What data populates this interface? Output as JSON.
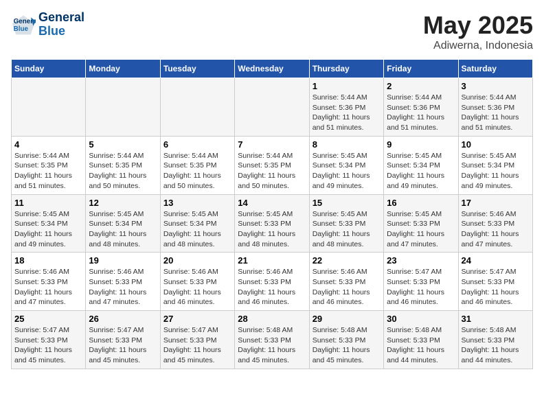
{
  "header": {
    "logo_line1": "General",
    "logo_line2": "Blue",
    "title": "May 2025",
    "subtitle": "Adiwerna, Indonesia"
  },
  "days_of_week": [
    "Sunday",
    "Monday",
    "Tuesday",
    "Wednesday",
    "Thursday",
    "Friday",
    "Saturday"
  ],
  "weeks": [
    [
      {
        "day": "",
        "info": ""
      },
      {
        "day": "",
        "info": ""
      },
      {
        "day": "",
        "info": ""
      },
      {
        "day": "",
        "info": ""
      },
      {
        "day": "1",
        "info": "Sunrise: 5:44 AM\nSunset: 5:36 PM\nDaylight: 11 hours\nand 51 minutes."
      },
      {
        "day": "2",
        "info": "Sunrise: 5:44 AM\nSunset: 5:36 PM\nDaylight: 11 hours\nand 51 minutes."
      },
      {
        "day": "3",
        "info": "Sunrise: 5:44 AM\nSunset: 5:36 PM\nDaylight: 11 hours\nand 51 minutes."
      }
    ],
    [
      {
        "day": "4",
        "info": "Sunrise: 5:44 AM\nSunset: 5:35 PM\nDaylight: 11 hours\nand 51 minutes."
      },
      {
        "day": "5",
        "info": "Sunrise: 5:44 AM\nSunset: 5:35 PM\nDaylight: 11 hours\nand 50 minutes."
      },
      {
        "day": "6",
        "info": "Sunrise: 5:44 AM\nSunset: 5:35 PM\nDaylight: 11 hours\nand 50 minutes."
      },
      {
        "day": "7",
        "info": "Sunrise: 5:44 AM\nSunset: 5:35 PM\nDaylight: 11 hours\nand 50 minutes."
      },
      {
        "day": "8",
        "info": "Sunrise: 5:45 AM\nSunset: 5:34 PM\nDaylight: 11 hours\nand 49 minutes."
      },
      {
        "day": "9",
        "info": "Sunrise: 5:45 AM\nSunset: 5:34 PM\nDaylight: 11 hours\nand 49 minutes."
      },
      {
        "day": "10",
        "info": "Sunrise: 5:45 AM\nSunset: 5:34 PM\nDaylight: 11 hours\nand 49 minutes."
      }
    ],
    [
      {
        "day": "11",
        "info": "Sunrise: 5:45 AM\nSunset: 5:34 PM\nDaylight: 11 hours\nand 49 minutes."
      },
      {
        "day": "12",
        "info": "Sunrise: 5:45 AM\nSunset: 5:34 PM\nDaylight: 11 hours\nand 48 minutes."
      },
      {
        "day": "13",
        "info": "Sunrise: 5:45 AM\nSunset: 5:34 PM\nDaylight: 11 hours\nand 48 minutes."
      },
      {
        "day": "14",
        "info": "Sunrise: 5:45 AM\nSunset: 5:33 PM\nDaylight: 11 hours\nand 48 minutes."
      },
      {
        "day": "15",
        "info": "Sunrise: 5:45 AM\nSunset: 5:33 PM\nDaylight: 11 hours\nand 48 minutes."
      },
      {
        "day": "16",
        "info": "Sunrise: 5:45 AM\nSunset: 5:33 PM\nDaylight: 11 hours\nand 47 minutes."
      },
      {
        "day": "17",
        "info": "Sunrise: 5:46 AM\nSunset: 5:33 PM\nDaylight: 11 hours\nand 47 minutes."
      }
    ],
    [
      {
        "day": "18",
        "info": "Sunrise: 5:46 AM\nSunset: 5:33 PM\nDaylight: 11 hours\nand 47 minutes."
      },
      {
        "day": "19",
        "info": "Sunrise: 5:46 AM\nSunset: 5:33 PM\nDaylight: 11 hours\nand 47 minutes."
      },
      {
        "day": "20",
        "info": "Sunrise: 5:46 AM\nSunset: 5:33 PM\nDaylight: 11 hours\nand 46 minutes."
      },
      {
        "day": "21",
        "info": "Sunrise: 5:46 AM\nSunset: 5:33 PM\nDaylight: 11 hours\nand 46 minutes."
      },
      {
        "day": "22",
        "info": "Sunrise: 5:46 AM\nSunset: 5:33 PM\nDaylight: 11 hours\nand 46 minutes."
      },
      {
        "day": "23",
        "info": "Sunrise: 5:47 AM\nSunset: 5:33 PM\nDaylight: 11 hours\nand 46 minutes."
      },
      {
        "day": "24",
        "info": "Sunrise: 5:47 AM\nSunset: 5:33 PM\nDaylight: 11 hours\nand 46 minutes."
      }
    ],
    [
      {
        "day": "25",
        "info": "Sunrise: 5:47 AM\nSunset: 5:33 PM\nDaylight: 11 hours\nand 45 minutes."
      },
      {
        "day": "26",
        "info": "Sunrise: 5:47 AM\nSunset: 5:33 PM\nDaylight: 11 hours\nand 45 minutes."
      },
      {
        "day": "27",
        "info": "Sunrise: 5:47 AM\nSunset: 5:33 PM\nDaylight: 11 hours\nand 45 minutes."
      },
      {
        "day": "28",
        "info": "Sunrise: 5:48 AM\nSunset: 5:33 PM\nDaylight: 11 hours\nand 45 minutes."
      },
      {
        "day": "29",
        "info": "Sunrise: 5:48 AM\nSunset: 5:33 PM\nDaylight: 11 hours\nand 45 minutes."
      },
      {
        "day": "30",
        "info": "Sunrise: 5:48 AM\nSunset: 5:33 PM\nDaylight: 11 hours\nand 44 minutes."
      },
      {
        "day": "31",
        "info": "Sunrise: 5:48 AM\nSunset: 5:33 PM\nDaylight: 11 hours\nand 44 minutes."
      }
    ]
  ]
}
